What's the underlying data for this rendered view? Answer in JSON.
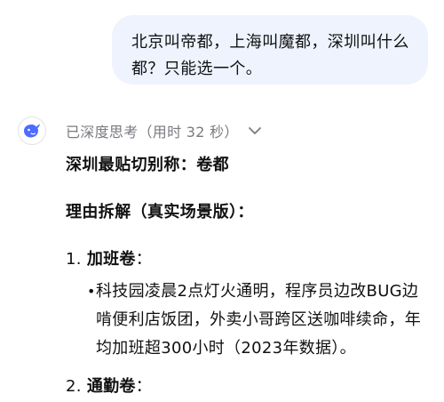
{
  "user_message": "北京叫帝都，上海叫魔都，深圳叫什么都？只能选一个。",
  "assistant": {
    "thinking_label": "已深度思考（用时 32 秒）",
    "headline": "深圳最贴切别称：卷都",
    "subheading": "理由拆解（真实场景版）：",
    "items": [
      {
        "number": "1.",
        "title": "加班卷",
        "title_suffix": "：",
        "bullet": "科技园凌晨2点灯火通明，程序员边改BUG边啃便利店饭团，外卖小哥跨区送咖啡续命，年均加班超300小时（2023年数据）。"
      },
      {
        "number": "2.",
        "title": "通勤卷",
        "title_suffix": "："
      }
    ]
  },
  "icons": {
    "avatar": "deepseek-whale-logo",
    "expand": "chevron-down-icon",
    "bullet": "bullet-dot"
  },
  "colors": {
    "bubble_bg": "#eef3fe",
    "brand_blue": "#4d6bfe",
    "muted_text": "#7a7a80"
  }
}
